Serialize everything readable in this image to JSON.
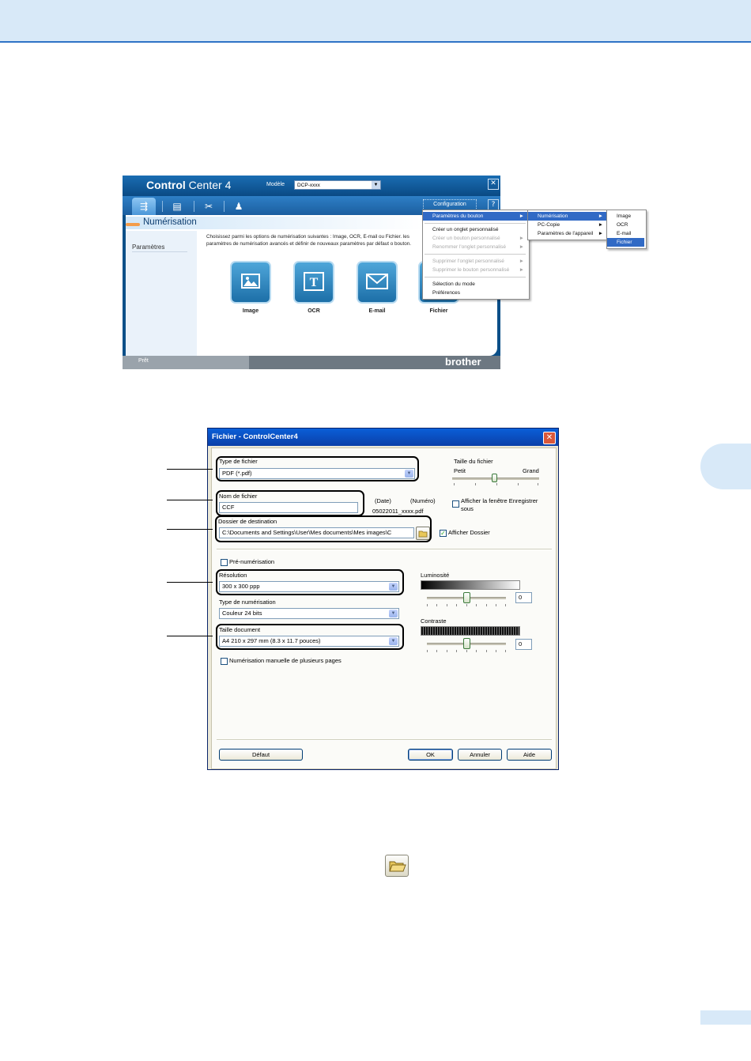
{
  "controlcenter": {
    "logo_bold": "Control",
    "logo_light": "Center 4",
    "model_label": "Modèle",
    "model_value": "DCP-xxxx",
    "configuration_label": "Configuration",
    "help_label": "?",
    "close_label": "✕",
    "section_title": "Numérisation",
    "sidebar_label": "Paramètres",
    "description": "Choisissez parmi les options de numérisation suivantes : Image, OCR, E-mail ou Fichier. les paramètres de numérisation avancés et définir de nouveaux paramètres par défaut o bouton.",
    "buttons": [
      {
        "label": "Image",
        "icon": "image-icon"
      },
      {
        "label": "OCR",
        "icon": "ocr-icon"
      },
      {
        "label": "E-mail",
        "icon": "email-icon"
      },
      {
        "label": "Fichier",
        "icon": "file-icon"
      }
    ],
    "status_text": "Prêt",
    "brand": "brother"
  },
  "context_menu": {
    "items": [
      {
        "label": "Paramètres du bouton",
        "selected": true,
        "submenu": true
      },
      {
        "label": "Créer un onglet personnalisé"
      },
      {
        "label": "Créer un bouton personnalisé",
        "disabled": true,
        "submenu": true
      },
      {
        "label": "Renommer l'onglet personnalisé",
        "disabled": true,
        "submenu": true
      },
      {
        "label": "Supprimer l'onglet personnalisé",
        "disabled": true,
        "submenu": true
      },
      {
        "label": "Supprimer le bouton personnalisé",
        "disabled": true,
        "submenu": true
      },
      {
        "label": "Sélection du mode"
      },
      {
        "label": "Préférences"
      }
    ],
    "submenu1": [
      {
        "label": "Numérisation",
        "selected": true
      },
      {
        "label": "PC-Copie"
      },
      {
        "label": "Paramètres de l'appareil"
      }
    ],
    "submenu2": [
      {
        "label": "Image"
      },
      {
        "label": "OCR"
      },
      {
        "label": "E-mail"
      },
      {
        "label": "Fichier",
        "selected": true
      }
    ]
  },
  "dialog": {
    "title": "Fichier - ControlCenter4",
    "file_type_label": "Type de fichier",
    "file_type_value": "PDF (*.pdf)",
    "file_size_label": "Taille du fichier",
    "file_size_small": "Petit",
    "file_size_large": "Grand",
    "file_name_label": "Nom de fichier",
    "file_name_value": "CCF",
    "date_label": "(Date)",
    "number_label": "(Numéro)",
    "file_name_preview": "05022011_xxxx.pdf",
    "show_save_as_label_1": "Afficher la fenêtre Enregistrer",
    "show_save_as_label_2": "sous",
    "destination_label": "Dossier de destination",
    "destination_value": "C:\\Documents and Settings\\User\\Mes documents\\Mes images\\C",
    "show_folder_label": "Afficher Dossier",
    "prescan_label": "Pré-numérisation",
    "resolution_label": "Résolution",
    "resolution_value": "300 x 300 ppp",
    "scan_type_label": "Type de numérisation",
    "scan_type_value": "Couleur 24 bits",
    "doc_size_label": "Taille document",
    "doc_size_value": "A4 210 x 297 mm (8.3 x 11.7 pouces)",
    "manual_multi_label": "Numérisation manuelle de plusieurs pages",
    "brightness_label": "Luminosité",
    "brightness_value": "0",
    "contrast_label": "Contraste",
    "contrast_value": "0",
    "btn_default": "Défaut",
    "btn_ok": "OK",
    "btn_cancel": "Annuler",
    "btn_help": "Aide"
  },
  "checkboxes": {
    "show_save_as": false,
    "show_folder": true,
    "prescan": false,
    "manual_multi": false
  },
  "icons": [
    "folder-browse-icon"
  ]
}
